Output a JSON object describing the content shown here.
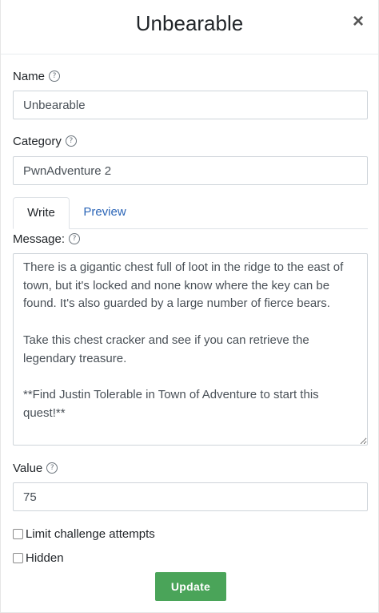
{
  "header": {
    "title": "Unbearable",
    "close_glyph": "×"
  },
  "fields": {
    "name": {
      "label": "Name",
      "value": "Unbearable"
    },
    "category": {
      "label": "Category",
      "value": "PwnAdventure 2"
    },
    "tabs": [
      {
        "label": "Write",
        "active": true
      },
      {
        "label": "Preview",
        "active": false
      }
    ],
    "message": {
      "label": "Message:",
      "value": "There is a gigantic chest full of loot in the ridge to the east of town, but it's locked and none know where the key can be found. It's also guarded by a large number of fierce bears.\n\nTake this chest cracker and see if you can retrieve the legendary treasure.\n\n**Find Justin Tolerable in Town of Adventure to start this quest!**"
    },
    "value": {
      "label": "Value",
      "value": "75"
    },
    "limit_attempts": {
      "label": "Limit challenge attempts",
      "checked": false
    },
    "hidden": {
      "label": "Hidden",
      "checked": false
    }
  },
  "help_glyph": "?",
  "actions": {
    "update_label": "Update"
  },
  "colors": {
    "primary_button": "#4aa459",
    "link": "#2b65b7"
  },
  "icons": {
    "help": "question-circle-icon",
    "close": "close-icon"
  }
}
